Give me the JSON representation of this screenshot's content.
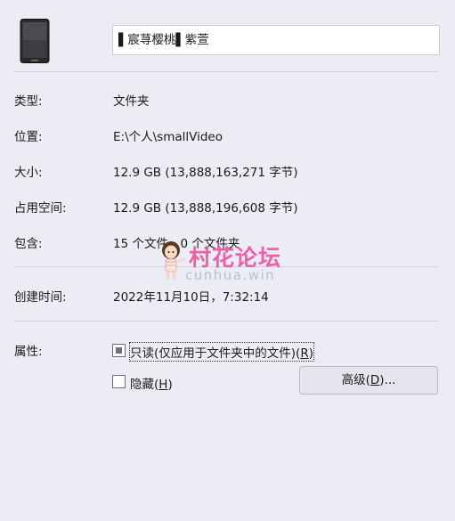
{
  "header": {
    "icon": "phone-folder-icon",
    "name_value": "▌宸荨樱桃▌紫萱"
  },
  "fields": {
    "type_label": "类型:",
    "type_value": "文件夹",
    "location_label": "位置:",
    "location_value": "E:\\个人\\smallVideo",
    "size_label": "大小:",
    "size_value": "12.9 GB (13,888,163,271 字节)",
    "disk_size_label": "占用空间:",
    "disk_size_value": "12.9 GB (13,888,196,608 字节)",
    "contains_label": "包含:",
    "contains_value": "15 个文件，0 个文件夹",
    "created_label": "创建时间:",
    "created_value": "2022年11月10日，7:32:14"
  },
  "attributes": {
    "label": "属性:",
    "readonly_label": "只读(仅应用于文件夹中的文件)(",
    "readonly_key": "R",
    "readonly_state": "indeterminate",
    "hidden_label": "隐藏(",
    "hidden_key": "H",
    "hidden_state": "unchecked",
    "advanced_label": "高级(",
    "advanced_key": "D",
    "advanced_suffix": ")..."
  },
  "watermark": {
    "title": "村花论坛",
    "subtitle": "cunhua.win"
  },
  "colors": {
    "background": "#ecedf4",
    "watermark_pink": "#f05fa6"
  }
}
